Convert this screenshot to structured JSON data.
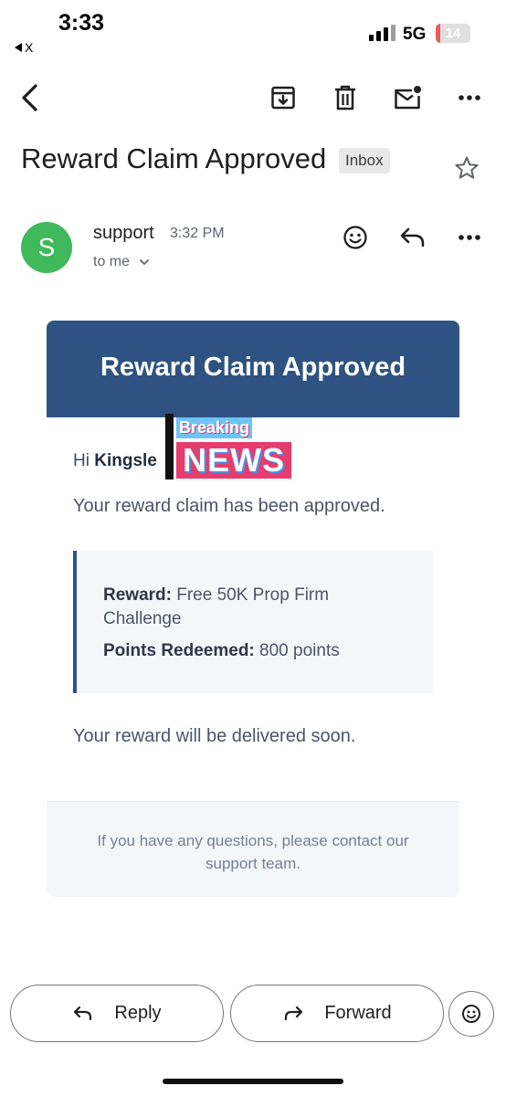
{
  "status_bar": {
    "time": "3:33",
    "back_app": "X",
    "network": "5G",
    "battery": "14",
    "battery_level": 0.14,
    "battery_color": "#ef5a5a"
  },
  "toolbar": {
    "icons": [
      "back-arrow-icon",
      "archive-icon",
      "trash-icon",
      "mark-unread-icon",
      "more-vert-icon"
    ]
  },
  "email": {
    "subject": "Reward Claim Approved",
    "label": "Inbox",
    "sender": "support",
    "time": "3:32 PM",
    "recipient": "to me",
    "avatar_letter": "S",
    "avatar_color": "#3fb95b"
  },
  "body": {
    "header_title": "Reward Claim Approved",
    "header_color": "#2e5382",
    "greeting_prefix": "Hi",
    "greeting_name": "Kingsle",
    "approved_text": "Your reward claim has been approved.",
    "reward_label": "Reward:",
    "reward_value": "Free 50K Prop Firm Challenge",
    "points_label": "Points Redeemed:",
    "points_value": "800 points",
    "delivered_text": "Your reward will be delivered soon.",
    "footer_text": "If you have any questions, please contact our support team."
  },
  "overlay": {
    "line1": "Breaking",
    "line2": "NEWS"
  },
  "actions": {
    "reply": "Reply",
    "forward": "Forward"
  }
}
